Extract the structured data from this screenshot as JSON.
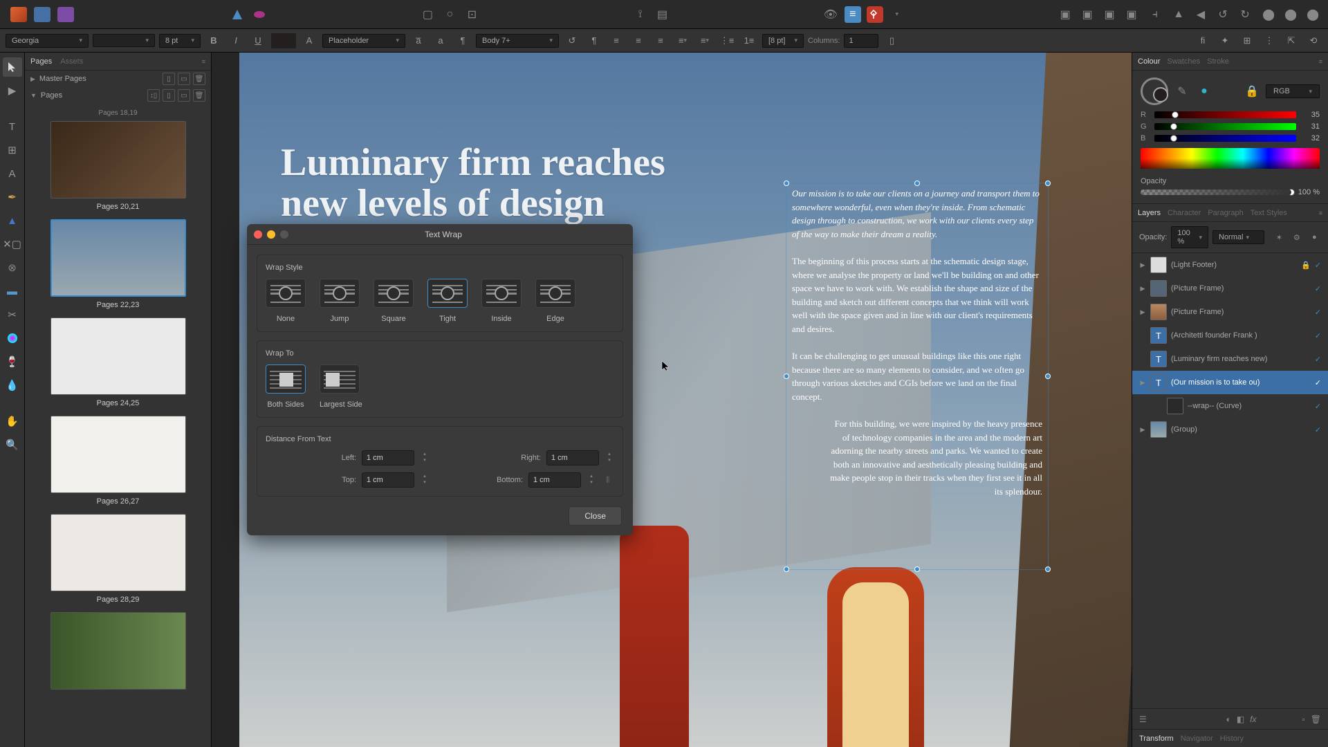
{
  "font": {
    "family": "Georgia",
    "size": "8 pt",
    "style_placeholder": "Placeholder",
    "paragraph_style": "Body 7+",
    "leading": "[8 pt]",
    "columns_label": "Columns:",
    "columns": "1"
  },
  "pages_panel": {
    "tabs": [
      "Pages",
      "Assets"
    ],
    "master_label": "Master Pages",
    "pages_label": "Pages",
    "thumbs": [
      {
        "label": "Pages 18,19"
      },
      {
        "label": "Pages 20,21"
      },
      {
        "label": "Pages 22,23"
      },
      {
        "label": "Pages 24,25"
      },
      {
        "label": "Pages 26,27"
      },
      {
        "label": "Pages 28,29"
      }
    ]
  },
  "canvas": {
    "headline": "Luminary firm reaches\nnew levels of design",
    "p1": "Our mission is to take our clients on a journey and transport them to somewhere wonderful, even when they're inside. From schematic design through to construction, we work with our clients every step of the way to make their dream a reality.",
    "p2": "The beginning of this process starts at the schematic design stage, where we analyse the property or land we'll be building on and other space we have to work with. We establish the shape and size of the building and sketch out different concepts that we think will work well with the space given and in line with our client's requirements and desires.",
    "p3": "It can be challenging to get unusual buildings like this one right because there are so many elements to consider, and we often go through various sketches and CGIs before we land on the final concept.",
    "p4": "For this building, we were inspired by the heavy presence of technology companies in the area and the modern art adorning the nearby streets and parks. We wanted to create both an innovative and aesthetically pleasing building and make people stop in their tracks when they first see it in all its splendour."
  },
  "dialog": {
    "title": "Text Wrap",
    "wrap_style_label": "Wrap Style",
    "styles": {
      "none": "None",
      "jump": "Jump",
      "square": "Square",
      "tight": "Tight",
      "inside": "Inside",
      "edge": "Edge"
    },
    "wrap_to_label": "Wrap To",
    "wrap_to": {
      "both": "Both Sides",
      "largest": "Largest Side"
    },
    "distance_label": "Distance From Text",
    "dist": {
      "left_l": "Left:",
      "left": "1 cm",
      "right_l": "Right:",
      "right": "1 cm",
      "top_l": "Top:",
      "top": "1 cm",
      "bottom_l": "Bottom:",
      "bottom": "1 cm"
    },
    "close": "Close"
  },
  "colour": {
    "tabs": [
      "Colour",
      "Swatches",
      "Stroke"
    ],
    "mode": "RGB",
    "r": "35",
    "g": "31",
    "b": "32",
    "opacity_label": "Opacity",
    "opacity": "100 %"
  },
  "layers": {
    "tabs": [
      "Layers",
      "Character",
      "Paragraph",
      "Text Styles"
    ],
    "opacity_label": "Opacity:",
    "opacity": "100 %",
    "blend": "Normal",
    "items": [
      {
        "name": "(Light Footer)",
        "type": "group",
        "locked": true
      },
      {
        "name": "(Picture Frame)",
        "type": "image"
      },
      {
        "name": "(Picture Frame)",
        "type": "image"
      },
      {
        "name": "(Architetti founder Frank )",
        "type": "text"
      },
      {
        "name": "(Luminary firm reaches new)",
        "type": "text"
      },
      {
        "name": "(Our mission is to take ou)",
        "type": "text",
        "selected": true
      },
      {
        "name": "--wrap-- (Curve)",
        "type": "curve",
        "indent": true
      },
      {
        "name": "(Group)",
        "type": "group"
      }
    ]
  },
  "bottom_tabs": {
    "transform": "Transform",
    "navigator": "Navigator",
    "history": "History"
  }
}
